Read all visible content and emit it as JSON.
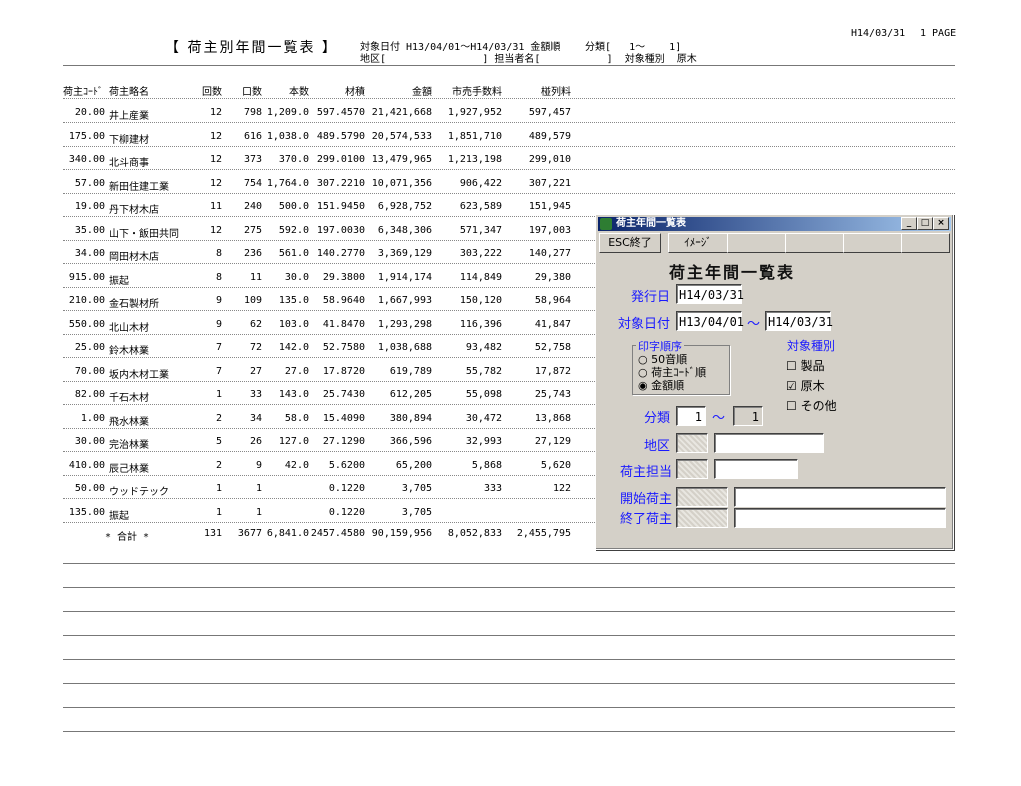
{
  "report": {
    "title": "【 荷主別年間一覧表 】",
    "criteria_line1": "対象日付 H13/04/01～H14/03/31 金額順",
    "criteria_line2": "地区[                ] 担当者名[           ]  対象種別  原木",
    "class_range": "分類[   1～    1]",
    "print_date": "H14/03/31",
    "page": "1 PAGE"
  },
  "columns": [
    "荷主ｺｰﾄﾞ",
    "荷主略名",
    "回数",
    "口数",
    "本数",
    "材積",
    "金額",
    "市売手数料",
    "椪列料"
  ],
  "rows": [
    [
      "20.00",
      "井上産業",
      "12",
      "798",
      "1,209.0",
      "597.4570",
      "21,421,668",
      "1,927,952",
      "597,457"
    ],
    [
      "175.00",
      "下柳建材",
      "12",
      "616",
      "1,038.0",
      "489.5790",
      "20,574,533",
      "1,851,710",
      "489,579"
    ],
    [
      "340.00",
      "北斗商事",
      "12",
      "373",
      "370.0",
      "299.0100",
      "13,479,965",
      "1,213,198",
      "299,010"
    ],
    [
      "57.00",
      "新田住建工業",
      "12",
      "754",
      "1,764.0",
      "307.2210",
      "10,071,356",
      "906,422",
      "307,221"
    ],
    [
      "19.00",
      "丹下材木店",
      "11",
      "240",
      "500.0",
      "151.9450",
      "6,928,752",
      "623,589",
      "151,945"
    ],
    [
      "35.00",
      "山下・飯田共同",
      "12",
      "275",
      "592.0",
      "197.0030",
      "6,348,306",
      "571,347",
      "197,003"
    ],
    [
      "34.00",
      "岡田材木店",
      "8",
      "236",
      "561.0",
      "140.2770",
      "3,369,129",
      "303,222",
      "140,277"
    ],
    [
      "915.00",
      "振起",
      "8",
      "11",
      "30.0",
      "29.3800",
      "1,914,174",
      "114,849",
      "29,380"
    ],
    [
      "210.00",
      "金石製材所",
      "9",
      "109",
      "135.0",
      "58.9640",
      "1,667,993",
      "150,120",
      "58,964"
    ],
    [
      "550.00",
      "北山木材",
      "9",
      "62",
      "103.0",
      "41.8470",
      "1,293,298",
      "116,396",
      "41,847"
    ],
    [
      "25.00",
      "鈴木林業",
      "7",
      "72",
      "142.0",
      "52.7580",
      "1,038,688",
      "93,482",
      "52,758"
    ],
    [
      "70.00",
      "坂内木材工業",
      "7",
      "27",
      "27.0",
      "17.8720",
      "619,789",
      "55,782",
      "17,872"
    ],
    [
      "82.00",
      "千石木材",
      "1",
      "33",
      "143.0",
      "25.7430",
      "612,205",
      "55,098",
      "25,743"
    ],
    [
      "1.00",
      "飛水林業",
      "2",
      "34",
      "58.0",
      "15.4090",
      "380,894",
      "30,472",
      "13,868"
    ],
    [
      "30.00",
      "完治林業",
      "5",
      "26",
      "127.0",
      "27.1290",
      "366,596",
      "32,993",
      "27,129"
    ],
    [
      "410.00",
      "辰己林業",
      "2",
      "9",
      "42.0",
      "5.6200",
      "65,200",
      "5,868",
      "5,620"
    ],
    [
      "50.00",
      "ウッドテック",
      "1",
      "1",
      "",
      "0.1220",
      "3,705",
      "333",
      "122"
    ],
    [
      "135.00",
      "振起",
      "1",
      "1",
      "",
      "0.1220",
      "3,705",
      "",
      ""
    ]
  ],
  "total": [
    "* 合計 *",
    "131",
    "3677",
    "6,841.0",
    "2457.4580",
    "90,159,956",
    "8,052,833",
    "2,455,795"
  ],
  "dialog": {
    "title": "荷主年間一覧表",
    "btn_min": "_",
    "btn_max": "□",
    "btn_close": "×",
    "esc_button": "ESC終了",
    "image_button": "ｲﾒｰｼﾞ",
    "heading": "荷主年間一覧表",
    "issue_date_label": "発行日",
    "issue_date": "H14/03/31",
    "target_date_label": "対象日付",
    "date_from": "H13/04/01",
    "date_sep": "～",
    "date_to": "H14/03/31",
    "print_order_label": "印字順序",
    "order_options": [
      "50音順",
      "荷主ｺｰﾄﾞ順",
      "金額順"
    ],
    "order_selected": 2,
    "target_type_label": "対象種別",
    "type_options": [
      "製品",
      "原木",
      "その他"
    ],
    "type_checked": [
      false,
      true,
      false
    ],
    "class_label": "分類",
    "class_from": "1",
    "class_sep": "～",
    "class_to": "1",
    "area_label": "地区",
    "owner_label": "荷主担当",
    "start_label": "開始荷主",
    "end_label": "終了荷主"
  }
}
